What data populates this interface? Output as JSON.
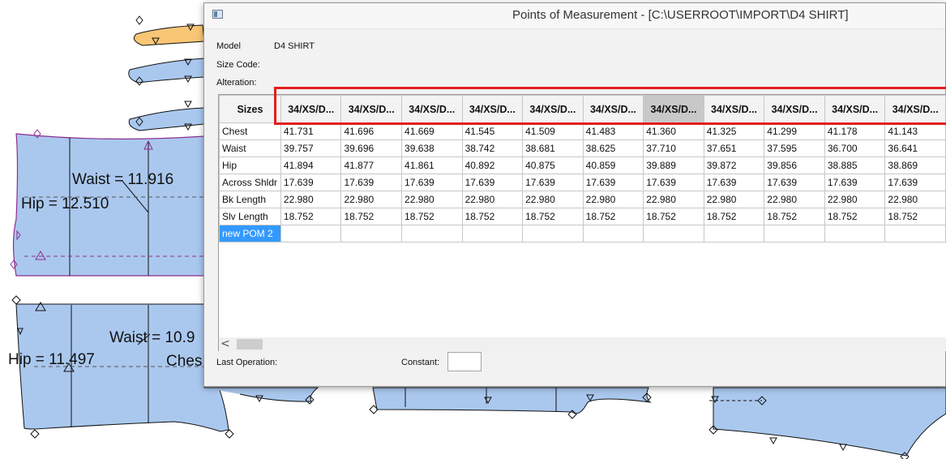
{
  "colors": {
    "piece_fill": "#aac8ee",
    "selected_piece_fill": "#f9c675",
    "accent_outline": "#e21e1e",
    "selected_row": "#3399ff"
  },
  "cad": {
    "labels": {
      "waist_1": "Waist = 11.916",
      "hip_1": "Hip = 12.510",
      "waist_2": "Waist = 10.9",
      "hip_2": "Hip = 11.497",
      "chest_2": "Ches"
    }
  },
  "dialog": {
    "title": "Points of Measurement - [C:\\USERROOT\\IMPORT\\D4 SHIRT]",
    "model_label": "Model",
    "model_value": "D4 SHIRT",
    "size_code_label": "Size Code:",
    "alteration_label": "Alteration:",
    "last_operation_label": "Last Operation:",
    "constant_label": "Constant:",
    "constant_value": "",
    "scroll_left_glyph": "<"
  },
  "table": {
    "corner_header": "Sizes",
    "columns": [
      "34/XS/D...",
      "34/XS/D...",
      "34/XS/D...",
      "34/XS/D...",
      "34/XS/D...",
      "34/XS/D...",
      "34/XS/D...",
      "34/XS/D...",
      "34/XS/D...",
      "34/XS/D...",
      "34/XS/D..."
    ],
    "selected_column": 6,
    "rows": [
      {
        "name": "Chest",
        "values": [
          "41.731",
          "41.696",
          "41.669",
          "41.545",
          "41.509",
          "41.483",
          "41.360",
          "41.325",
          "41.299",
          "41.178",
          "41.143"
        ]
      },
      {
        "name": "Waist",
        "values": [
          "39.757",
          "39.696",
          "39.638",
          "38.742",
          "38.681",
          "38.625",
          "37.710",
          "37.651",
          "37.595",
          "36.700",
          "36.641"
        ]
      },
      {
        "name": "Hip",
        "values": [
          "41.894",
          "41.877",
          "41.861",
          "40.892",
          "40.875",
          "40.859",
          "39.889",
          "39.872",
          "39.856",
          "38.885",
          "38.869"
        ]
      },
      {
        "name": "Across Shldr",
        "values": [
          "17.639",
          "17.639",
          "17.639",
          "17.639",
          "17.639",
          "17.639",
          "17.639",
          "17.639",
          "17.639",
          "17.639",
          "17.639"
        ]
      },
      {
        "name": "Bk Length",
        "values": [
          "22.980",
          "22.980",
          "22.980",
          "22.980",
          "22.980",
          "22.980",
          "22.980",
          "22.980",
          "22.980",
          "22.980",
          "22.980"
        ]
      },
      {
        "name": "Slv Length",
        "values": [
          "18.752",
          "18.752",
          "18.752",
          "18.752",
          "18.752",
          "18.752",
          "18.752",
          "18.752",
          "18.752",
          "18.752",
          "18.752"
        ]
      }
    ],
    "new_row_label": "new POM 2"
  }
}
